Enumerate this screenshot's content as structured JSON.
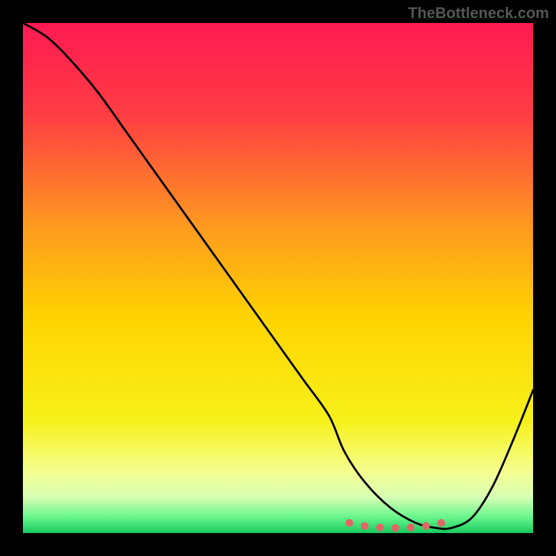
{
  "watermark": "TheBottleneck.com",
  "chart_data": {
    "type": "line",
    "title": "",
    "xlabel": "",
    "ylabel": "",
    "xlim": [
      0,
      100
    ],
    "ylim": [
      0,
      100
    ],
    "gradient_stops": [
      {
        "offset": 0.0,
        "color": "#ff1a52"
      },
      {
        "offset": 0.18,
        "color": "#ff3d43"
      },
      {
        "offset": 0.4,
        "color": "#ff9a1f"
      },
      {
        "offset": 0.58,
        "color": "#ffd400"
      },
      {
        "offset": 0.78,
        "color": "#f7f11a"
      },
      {
        "offset": 0.88,
        "color": "#f5ff90"
      },
      {
        "offset": 0.93,
        "color": "#d6ffb4"
      },
      {
        "offset": 0.97,
        "color": "#64f58a"
      },
      {
        "offset": 1.0,
        "color": "#18c95e"
      }
    ],
    "series": [
      {
        "name": "bottleneck-curve",
        "color": "#000000",
        "x": [
          0,
          5,
          10,
          15,
          20,
          25,
          30,
          35,
          40,
          45,
          50,
          55,
          60,
          63,
          67,
          72,
          77,
          81,
          84,
          88,
          92,
          96,
          100
        ],
        "y": [
          100,
          97,
          92,
          86,
          79,
          72,
          65,
          58,
          51,
          44,
          37,
          30,
          23,
          16,
          10,
          5,
          2,
          1,
          1,
          3,
          9,
          18,
          28
        ]
      },
      {
        "name": "optimal-band",
        "color": "#e06666",
        "type": "scatter",
        "x": [
          64,
          67,
          70,
          73,
          76,
          79,
          82
        ],
        "y": [
          2.0,
          1.4,
          1.1,
          1.0,
          1.1,
          1.4,
          2.0
        ]
      }
    ]
  }
}
